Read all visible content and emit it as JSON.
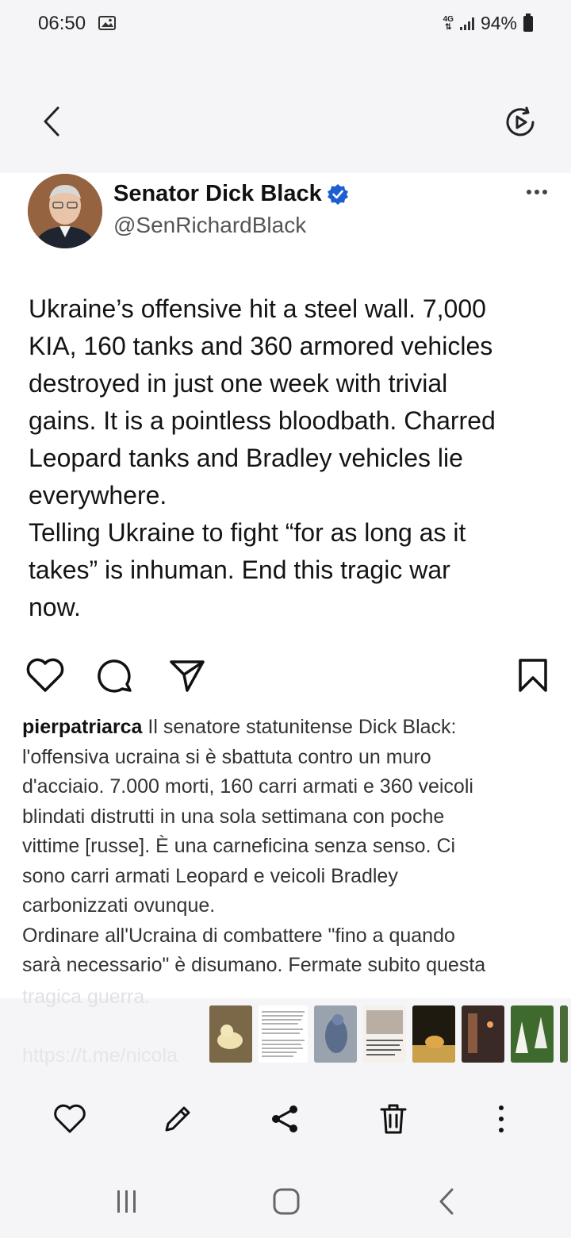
{
  "status_bar": {
    "time": "06:50",
    "network": "4G",
    "battery": "94%",
    "icons": [
      "gallery-icon",
      "signal-icon",
      "battery-icon"
    ]
  },
  "top_bar": {
    "icons": [
      "back-icon",
      "motion-photo-icon"
    ]
  },
  "tweet": {
    "display_name": "Senator Dick Black",
    "handle": "@SenRichardBlack",
    "verified": true,
    "text": "Ukraine’s offensive hit a steel wall. 7,000\nKIA, 160 tanks and 360 armored vehicles\ndestroyed in just one week with trivial\ngains. It is a pointless bloodbath. Charred\nLeopard tanks and Bradley vehicles lie\neverywhere.\nTelling Ukraine to fight “for as long as it\ntakes” is inhuman. End this tragic war\nnow.",
    "accent_color": "#1d5fd1"
  },
  "post_actions": {
    "icons": [
      "heart-icon",
      "comment-icon",
      "share-icon",
      "bookmark-icon"
    ]
  },
  "caption": {
    "username": "pierpatriarca",
    "text": " Il senatore statunitense Dick Black:\nl'offensiva ucraina si è sbattuta contro un muro\nd'acciaio. 7.000 morti, 160 carri armati e 360 veicoli\nblindati distrutti in una sola settimana con poche\nvittime [russe]. È una carneficina senza senso. Ci\nsono carri armati Leopard e veicoli Bradley\ncarbonizzati ovunque.\nOrdinare all'Ucraina di combattere \"fino a quando\nsarà necessario\" è disumano. Fermate subito questa",
    "faded_line": "tragica guerra.",
    "link_faded": "https://t.me/nicola"
  },
  "filmstrip": {
    "thumbnails": [
      "chick",
      "screenshot-text",
      "heron",
      "document",
      "amber-figure",
      "dark-scene",
      "white-flowers",
      "partial"
    ],
    "selected": "screenshot-text"
  },
  "gallery_actions": {
    "icons": [
      "favorite-icon",
      "edit-icon",
      "share-icon",
      "delete-icon",
      "more-icon"
    ]
  },
  "nav_bar": {
    "icons": [
      "recents-icon",
      "home-icon",
      "back-nav-icon"
    ]
  }
}
